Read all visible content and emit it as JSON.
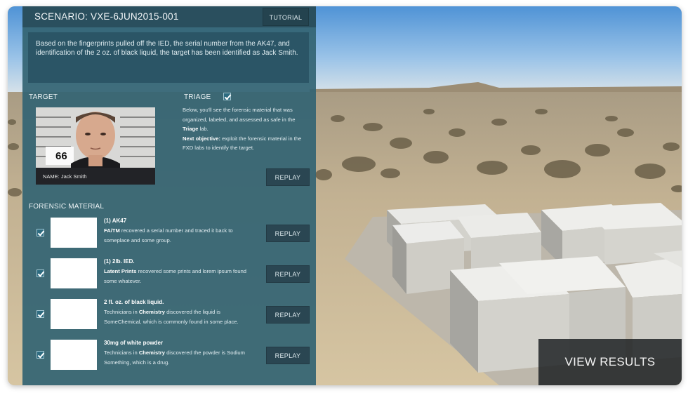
{
  "header": {
    "scenario_title": "SCENARIO: VXE-6JUN2015-001",
    "tutorial_label": "TUTORIAL"
  },
  "summary": "Based on the fingerprints pulled off the IED, the serial number from the AK47, and identification of the 2 oz. of black liquid, the target has been identified as Jack Smith.",
  "target": {
    "label": "TARGET",
    "name_caption": "NAME: Jack Smith",
    "sign_number": "66"
  },
  "triage": {
    "label": "TRIAGE",
    "checked": true,
    "text_1": "Below, you'll see the forensic material that was organized, labeled, and assessed as safe in the ",
    "text_1_bold": "Triage",
    "text_1_end": " lab.",
    "objective_label": "Next objective:",
    "objective_text": " exploit the forensic material in the FXD labs to identify the target.",
    "replay_label": "REPLAY"
  },
  "forensic": {
    "label": "FORENSIC MATERIAL",
    "items": [
      {
        "title": "(1) AK47",
        "lab": "FA/TM",
        "desc_pre": "",
        "desc": " recovered a serial number and traced it back to someplace and some group.",
        "checked": true,
        "replay_label": "REPLAY"
      },
      {
        "title": "(1) 2lb. IED.",
        "lab": "Latent Prints",
        "desc_pre": "",
        "desc": " recovered some prints and lorem ipsum found some whatever.",
        "checked": true,
        "replay_label": "REPLAY"
      },
      {
        "title": "2 fl. oz. of black liquid.",
        "lab": "Chemistry",
        "desc_pre": "Technicians in ",
        "desc": " discovered the liquid is SomeChemical, which is commonly found in some place.",
        "checked": true,
        "replay_label": "REPLAY"
      },
      {
        "title": "30mg of white powder",
        "lab": "Chemistry",
        "desc_pre": "Technicians in ",
        "desc": " discovered the powder is Sodium Something, which is a drug.",
        "checked": true,
        "replay_label": "REPLAY"
      }
    ]
  },
  "view_results_label": "VIEW RESULTS",
  "colors": {
    "panel": "#346473",
    "header": "#2a4f5e",
    "button": "#2a4652",
    "sky_top": "#5fa0dc",
    "sand": "#c9b896"
  }
}
